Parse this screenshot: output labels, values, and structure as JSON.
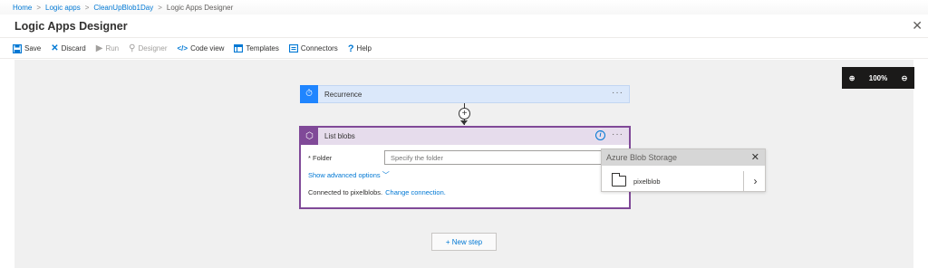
{
  "breadcrumb": {
    "items": [
      "Home",
      "Logic apps",
      "CleanUpBlob1Day",
      "Logic Apps Designer"
    ],
    "separator": ">"
  },
  "header": {
    "title": "Logic Apps Designer",
    "close_icon": "close-icon"
  },
  "toolbar": {
    "save": {
      "label": "Save",
      "icon": "save-icon",
      "enabled": true
    },
    "discard": {
      "label": "Discard",
      "icon": "discard-icon",
      "enabled": true
    },
    "run": {
      "label": "Run",
      "icon": "run-icon",
      "enabled": false
    },
    "designer": {
      "label": "Designer",
      "icon": "designer-icon",
      "enabled": false
    },
    "code_view": {
      "label": "Code view",
      "icon": "code-icon",
      "enabled": true
    },
    "templates": {
      "label": "Templates",
      "icon": "templates-icon",
      "enabled": true
    },
    "connectors": {
      "label": "Connectors",
      "icon": "connectors-icon",
      "enabled": true
    },
    "help": {
      "label": "Help",
      "icon": "help-icon",
      "enabled": true
    }
  },
  "zoom": {
    "level": "100%",
    "zoom_in_icon": "zoom-in-icon",
    "zoom_out_icon": "zoom-out-icon"
  },
  "steps": {
    "recurrence": {
      "title": "Recurrence",
      "more": "···"
    },
    "list_blobs": {
      "title": "List blobs",
      "more": "···",
      "folder_label": "* Folder",
      "folder_placeholder": "Specify the folder",
      "folder_value": "",
      "advanced_label": "Show advanced options",
      "connected_text": "Connected to pixelblobs.",
      "change_connection": "Change connection."
    },
    "new_step": "+ New step"
  },
  "folder_picker": {
    "title": "Azure Blob Storage",
    "items": [
      {
        "label": "pixelblob"
      }
    ]
  },
  "colors": {
    "accent": "#0078d4",
    "recurrence_icon_bg": "#1f85ff",
    "blob_icon_bg": "#804998",
    "blob_header_bg": "#e6dcec",
    "recurrence_bg": "#dbe8fa",
    "canvas_bg": "#f0f0f0"
  }
}
